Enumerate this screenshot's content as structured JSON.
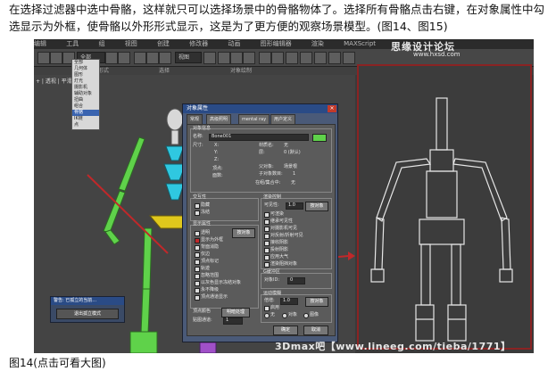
{
  "caption": "在选择过滤器中选中骨骼，这样就只可以选择场景中的骨骼物体了。选择所有骨骼点击右键，在对象属性中勾选显示为外框，使骨骼以外形形式显示，这是为了更方便的观察场景模型。(图14、图15)",
  "figure_label": "图14(点击可看大图)",
  "watermark": {
    "forum": "思缘设计论坛",
    "forum_url": "www.hxsd.com",
    "bottom": "3Dmax吧【www.lineeg.com/tieba/1771】"
  },
  "menu": [
    "编辑",
    "工具",
    "组",
    "视图",
    "创建",
    "修改器",
    "动画",
    "图形编辑器",
    "渲染",
    "MAXScript",
    "帮助"
  ],
  "toolbar": {
    "filter_value": "全部",
    "view_value": "视图"
  },
  "subbar": [
    "自由形式",
    "选择",
    "对象绘制"
  ],
  "viewport_label": "+ | 透视 | 平滑",
  "filter_dropdown": {
    "items": [
      "全部",
      "几何体",
      "图形",
      "灯光",
      "摄影机",
      "辅助对象",
      "扭曲",
      "组合",
      "骨骼",
      "IK链",
      "点",
      "CAT骨骼"
    ],
    "selected": "骨骼"
  },
  "dialog": {
    "title": "对象属性",
    "close": "×",
    "tabs": [
      "常规",
      "高级照明",
      "mental ray",
      "用户定义"
    ],
    "info_header": "对象信息",
    "name_label": "名称:",
    "name_value": "Bone001",
    "dims_label": "尺寸:",
    "x_label": "X:",
    "y_label": "Y:",
    "z_label": "Z:",
    "verts_label": "顶点:",
    "faces_label": "面数:",
    "material_label": "材质名:",
    "material_value": "无",
    "layer_label": "层:",
    "layer_value": "0 (默认)",
    "parent_label": "父对象:",
    "parent_value": "场景根",
    "children_label": "子对象数目:",
    "children_value": "1",
    "group_label": "在组/集合中:",
    "group_value": "无",
    "interaction_header": "交互性",
    "hide_label": "隐藏",
    "freeze_label": "冻结",
    "display_header": "显示属性",
    "display_items": [
      "透明",
      "显示为外框",
      "背面消隐",
      "仅边",
      "顶点标记",
      "轨迹",
      "忽略范围",
      "以灰色显示冻结对象",
      "永不降级",
      "顶点通道显示"
    ],
    "display_checked": "显示为外框",
    "by_layer_button": "按对象",
    "vertex_color_label": "顶点颜色",
    "shading_button": "明暗处理",
    "map_channel_label": "贴图通道:",
    "map_channel_value": "1",
    "render_header": "渲染控制",
    "visibility_label": "可见性:",
    "visibility_value": "1.0",
    "render_items": [
      "可渲染",
      "继承可见性",
      "对摄影机可见",
      "对反射/折射可见",
      "接收阴影",
      "投射阴影",
      "应用大气",
      "渲染阻挡对象"
    ],
    "gbuffer_header": "G缓冲区",
    "object_id_label": "对象ID:",
    "object_id_value": "0",
    "motion_blur_header": "运动模糊",
    "multiplier_label": "倍增:",
    "multiplier_value": "1.0",
    "enable_label": "启用",
    "blur_none": "无",
    "blur_object": "对象",
    "blur_image": "图像",
    "ok_button": "确定",
    "cancel_button": "取消"
  },
  "isolate_dialog": {
    "title": "警告: 已孤立的当前...",
    "button": "退出孤立模式"
  },
  "colors": {
    "highlight_arrow": "#c0282a",
    "bone_green": "#5fd24a",
    "bone_yellow": "#e0c81c",
    "bone_cyan": "#2fc8e0",
    "wireframe": "#e6e6e6",
    "viewport_border": "#8a2323"
  }
}
